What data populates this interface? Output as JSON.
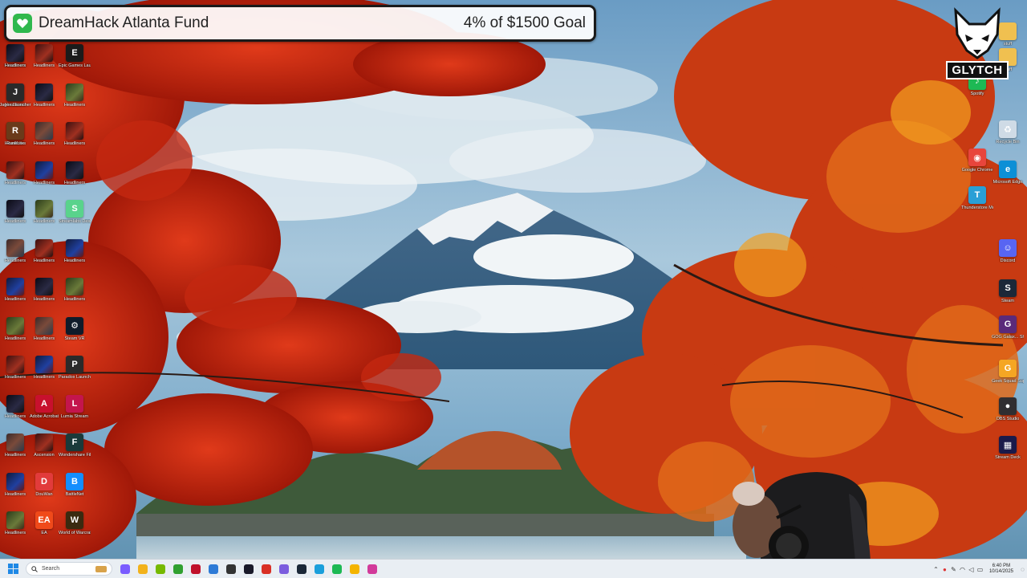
{
  "donation": {
    "title": "DreamHack Atlanta Fund",
    "goal_text": "4% of $1500 Goal",
    "progress_fraction": 0.04,
    "accent_color": "#2fb84d"
  },
  "desktop_left": {
    "icons": [
      {
        "label": "Headliners",
        "icon": "game-thumbnail"
      },
      {
        "label": "Headliners",
        "icon": "game-thumbnail"
      },
      {
        "label": "Headliners",
        "icon": "game-thumbnail"
      },
      {
        "label": "Headliners",
        "icon": "game-thumbnail"
      },
      {
        "label": "Headliners",
        "icon": "game-thumbnail"
      },
      {
        "label": "Headliners",
        "icon": "game-thumbnail"
      },
      {
        "label": "Headliners",
        "icon": "game-thumbnail"
      },
      {
        "label": "Headliners",
        "icon": "game-thumbnail"
      },
      {
        "label": "Headliners",
        "icon": "game-thumbnail"
      },
      {
        "label": "Headliners",
        "icon": "game-thumbnail"
      },
      {
        "label": "Headliners",
        "icon": "game-thumbnail"
      },
      {
        "label": "Headliners",
        "icon": "game-thumbnail"
      },
      {
        "label": "Headliners",
        "icon": "game-thumbnail"
      },
      {
        "label": "Headliners",
        "icon": "game-thumbnail"
      },
      {
        "label": "Headliners",
        "icon": "game-thumbnail"
      },
      {
        "label": "Headliners",
        "icon": "game-thumbnail"
      },
      {
        "label": "Headliners",
        "icon": "game-thumbnail"
      },
      {
        "label": "Headliners",
        "icon": "game-thumbnail"
      },
      {
        "label": "Headliners",
        "icon": "game-thumbnail"
      },
      {
        "label": "Headliners",
        "icon": "game-thumbnail"
      },
      {
        "label": "Headliners",
        "icon": "game-thumbnail"
      },
      {
        "label": "Headliners",
        "icon": "game-thumbnail"
      },
      {
        "label": "Adobe Acrobat",
        "icon": "acrobat-icon"
      },
      {
        "label": "Ascension",
        "icon": "game-thumbnail"
      },
      {
        "label": "DouWan",
        "icon": "douwan-icon"
      },
      {
        "label": "EA",
        "icon": "ea-icon"
      },
      {
        "label": "Epic Games Launcher",
        "icon": "epic-games-icon"
      },
      {
        "label": "Headliners",
        "icon": "game-thumbnail"
      },
      {
        "label": "Headliners",
        "icon": "game-thumbnail"
      },
      {
        "label": "Headliners",
        "icon": "game-thumbnail"
      },
      {
        "label": "Streamlabs Desktop",
        "icon": "streamlabs-icon"
      },
      {
        "label": "Headliners",
        "icon": "game-thumbnail"
      },
      {
        "label": "Headliners",
        "icon": "game-thumbnail"
      },
      {
        "label": "Steam VR",
        "icon": "steamvr-icon"
      },
      {
        "label": "Paradox Launcher",
        "icon": "paradox-icon"
      },
      {
        "label": "Lumia Stream",
        "icon": "lumia-icon"
      },
      {
        "label": "Wondershare Filmora",
        "icon": "filmora-icon"
      },
      {
        "label": "BattleNet",
        "icon": "battlenet-icon"
      },
      {
        "label": "World of Warcraft",
        "icon": "wow-icon"
      },
      {
        "label": "Headliners",
        "icon": "game-thumbnail"
      },
      {
        "label": "Jagex Launcher",
        "icon": "jagex-icon"
      },
      {
        "label": "RuneLite",
        "icon": "runelite-icon"
      }
    ]
  },
  "desktop_right": {
    "icons": [
      {
        "label": "stuff",
        "icon": "folder-icon"
      },
      {
        "label": "stuff",
        "icon": "folder-icon"
      },
      {
        "label": "Spotify",
        "icon": "spotify-icon"
      },
      {
        "label": "Recycle Bin",
        "icon": "recycle-bin-icon"
      },
      {
        "label": "Google Chrome",
        "icon": "chrome-icon"
      },
      {
        "label": "Microsoft Edge",
        "icon": "edge-icon"
      },
      {
        "label": "Thunderstore Mod Mana...",
        "icon": "thunderstore-icon"
      },
      {
        "label": "Discord",
        "icon": "discord-icon"
      },
      {
        "label": "Steam",
        "icon": "steam-icon"
      },
      {
        "label": "GOG Galax... Shortcut",
        "icon": "gog-icon"
      },
      {
        "label": "Geek Squad Support.exe",
        "icon": "geeksquad-icon"
      },
      {
        "label": "OBS Studio",
        "icon": "obs-icon"
      },
      {
        "label": "Stream Deck",
        "icon": "streamdeck-icon"
      }
    ]
  },
  "logo": {
    "text": "GLYTCH"
  },
  "taskbar": {
    "search_placeholder": "Search",
    "apps": [
      {
        "name": "copilot",
        "color": "#7a5cff"
      },
      {
        "name": "file-explorer",
        "color": "#f2b21b"
      },
      {
        "name": "nvidia",
        "color": "#76b900"
      },
      {
        "name": "xbox",
        "color": "#30a030"
      },
      {
        "name": "adobe",
        "color": "#c0112b"
      },
      {
        "name": "calculator",
        "color": "#2d7ad6"
      },
      {
        "name": "terminal",
        "color": "#333333"
      },
      {
        "name": "app-media",
        "color": "#1a1a2a"
      },
      {
        "name": "chrome-dev",
        "color": "#d93025"
      },
      {
        "name": "app-purple",
        "color": "#7b5dde"
      },
      {
        "name": "steam",
        "color": "#1b2838"
      },
      {
        "name": "edge",
        "color": "#1a9fdb"
      },
      {
        "name": "spotify",
        "color": "#1db954"
      },
      {
        "name": "chrome",
        "color": "#f4b400"
      },
      {
        "name": "app-pink",
        "color": "#d23a9a"
      }
    ],
    "clock_time": "6:40 PM",
    "clock_date": "10/14/2025"
  }
}
